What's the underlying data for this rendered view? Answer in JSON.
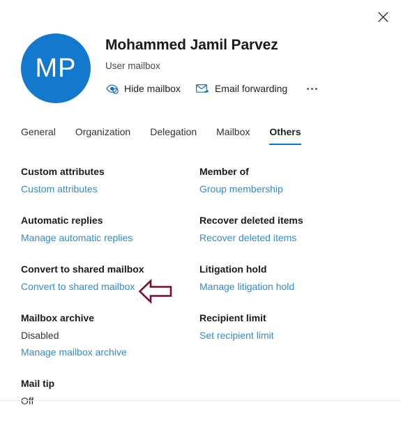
{
  "window": {
    "close_label": "Close",
    "close_icon": "close-icon"
  },
  "header": {
    "avatar_initials": "MP",
    "avatar_color": "#1379ce",
    "name": "Mohammed Jamil Parvez",
    "subtitle": "User mailbox",
    "commands": [
      {
        "label": "Hide mailbox",
        "icon": "hide-mailbox-icon"
      },
      {
        "label": "Email forwarding",
        "icon": "email-forwarding-icon"
      }
    ],
    "overflow_label": "More options",
    "overflow_icon": "more-options-icon"
  },
  "tabs": [
    {
      "label": "General",
      "active": false
    },
    {
      "label": "Organization",
      "active": false
    },
    {
      "label": "Delegation",
      "active": false
    },
    {
      "label": "Mailbox",
      "active": false
    },
    {
      "label": "Others",
      "active": true
    }
  ],
  "tab_accent_color": "#0078d4",
  "link_color": "#2e8bd4",
  "sections": [
    {
      "title": "Custom attributes",
      "status": null,
      "link": "Custom attributes"
    },
    {
      "title": "Member of",
      "status": null,
      "link": "Group membership"
    },
    {
      "title": "Automatic replies",
      "status": null,
      "link": "Manage automatic replies"
    },
    {
      "title": "Recover deleted items",
      "status": null,
      "link": "Recover deleted items"
    },
    {
      "title": "Convert to shared mailbox",
      "status": null,
      "link": "Convert to shared mailbox"
    },
    {
      "title": "Litigation hold",
      "status": null,
      "link": "Manage litigation hold"
    },
    {
      "title": "Mailbox archive",
      "status": "Disabled",
      "link": "Manage mailbox archive"
    },
    {
      "title": "Recipient limit",
      "status": null,
      "link": "Set recipient limit"
    },
    {
      "title": "Mail tip",
      "status": "Off",
      "link": null
    }
  ],
  "annotation": {
    "shape": "left-arrow",
    "color": "#7a0c28",
    "points_at": "Convert to shared mailbox"
  }
}
